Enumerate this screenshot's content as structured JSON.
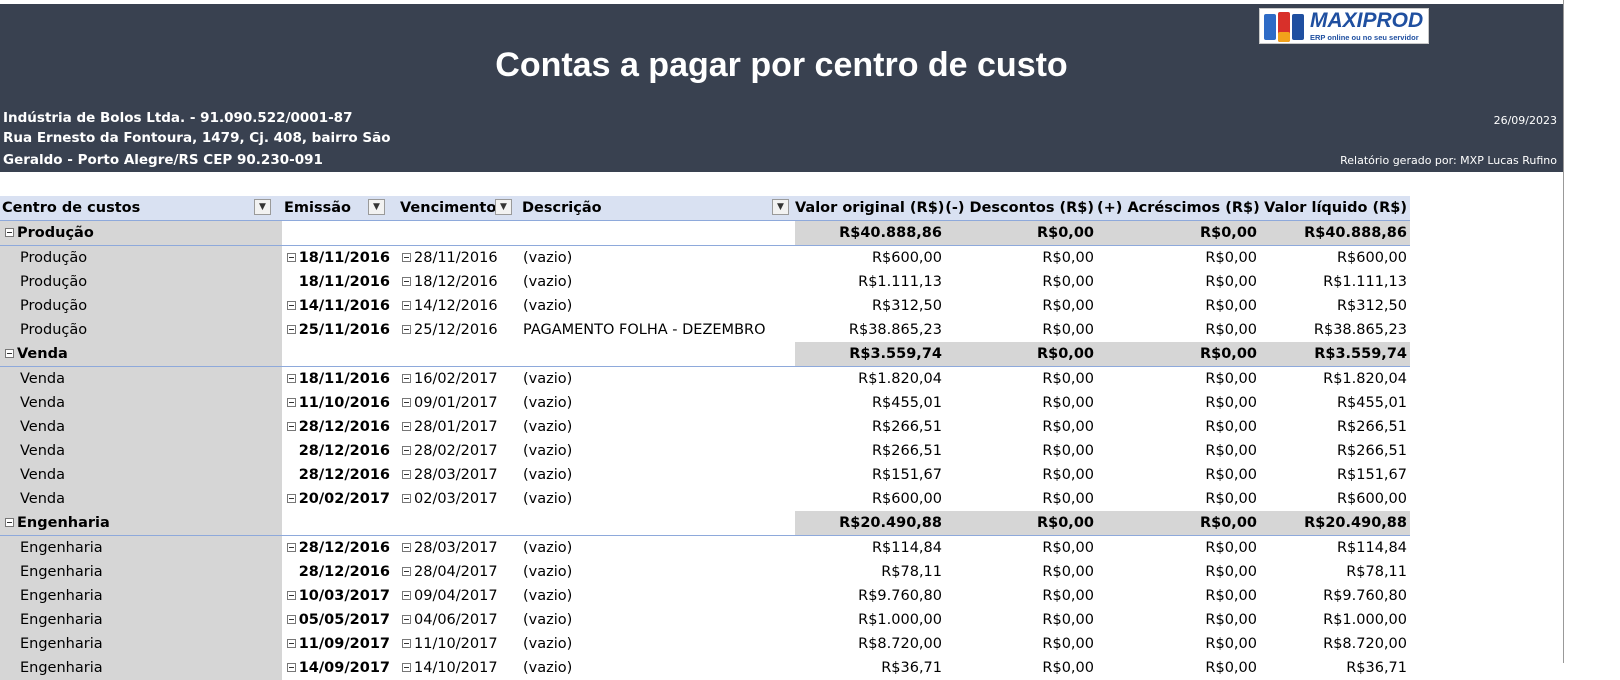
{
  "report": {
    "title": "Contas a pagar por centro de custo",
    "company_line1": "Indústria de Bolos Ltda. - 91.090.522/0001-87",
    "company_line2": "Rua Ernesto da Fontoura, 1479, Cj. 408, bairro São",
    "company_line3": "Geraldo - Porto Alegre/RS CEP 90.230-091",
    "date": "26/09/2023",
    "generated_by": "Relatório gerado por: MXP Lucas Rufino"
  },
  "logo": {
    "name": "MAXIPROD",
    "tagline": "ERP online ou no seu servidor"
  },
  "columns": [
    "Centro de custos",
    "Emissão",
    "Vencimento",
    "Descrição",
    "Valor original (R$)",
    "(-) Descontos (R$)",
    "(+) Acréscimos (R$)",
    "Valor líquido (R$)"
  ],
  "groups": [
    {
      "name": "Produção",
      "totals": [
        "R$40.888,86",
        "R$0,00",
        "R$0,00",
        "R$40.888,86"
      ],
      "rows": [
        {
          "center": "Produção",
          "emissao": "18/11/2016",
          "emissao_toggle": true,
          "vencimento": "28/11/2016",
          "descricao": "(vazio)",
          "valores": [
            "R$600,00",
            "R$0,00",
            "R$0,00",
            "R$600,00"
          ]
        },
        {
          "center": "Produção",
          "emissao": "18/11/2016",
          "emissao_toggle": false,
          "vencimento": "18/12/2016",
          "descricao": "(vazio)",
          "valores": [
            "R$1.111,13",
            "R$0,00",
            "R$0,00",
            "R$1.111,13"
          ]
        },
        {
          "center": "Produção",
          "emissao": "14/11/2016",
          "emissao_toggle": true,
          "vencimento": "14/12/2016",
          "descricao": "(vazio)",
          "valores": [
            "R$312,50",
            "R$0,00",
            "R$0,00",
            "R$312,50"
          ]
        },
        {
          "center": "Produção",
          "emissao": "25/11/2016",
          "emissao_toggle": true,
          "vencimento": "25/12/2016",
          "descricao": "PAGAMENTO FOLHA - DEZEMBRO",
          "valores": [
            "R$38.865,23",
            "R$0,00",
            "R$0,00",
            "R$38.865,23"
          ]
        }
      ]
    },
    {
      "name": "Venda",
      "totals": [
        "R$3.559,74",
        "R$0,00",
        "R$0,00",
        "R$3.559,74"
      ],
      "rows": [
        {
          "center": "Venda",
          "emissao": "18/11/2016",
          "emissao_toggle": true,
          "vencimento": "16/02/2017",
          "descricao": "(vazio)",
          "valores": [
            "R$1.820,04",
            "R$0,00",
            "R$0,00",
            "R$1.820,04"
          ]
        },
        {
          "center": "Venda",
          "emissao": "11/10/2016",
          "emissao_toggle": true,
          "vencimento": "09/01/2017",
          "descricao": "(vazio)",
          "valores": [
            "R$455,01",
            "R$0,00",
            "R$0,00",
            "R$455,01"
          ]
        },
        {
          "center": "Venda",
          "emissao": "28/12/2016",
          "emissao_toggle": true,
          "vencimento": "28/01/2017",
          "descricao": "(vazio)",
          "valores": [
            "R$266,51",
            "R$0,00",
            "R$0,00",
            "R$266,51"
          ]
        },
        {
          "center": "Venda",
          "emissao": "28/12/2016",
          "emissao_toggle": false,
          "vencimento": "28/02/2017",
          "descricao": "(vazio)",
          "valores": [
            "R$266,51",
            "R$0,00",
            "R$0,00",
            "R$266,51"
          ]
        },
        {
          "center": "Venda",
          "emissao": "28/12/2016",
          "emissao_toggle": false,
          "vencimento": "28/03/2017",
          "descricao": "(vazio)",
          "valores": [
            "R$151,67",
            "R$0,00",
            "R$0,00",
            "R$151,67"
          ]
        },
        {
          "center": "Venda",
          "emissao": "20/02/2017",
          "emissao_toggle": true,
          "vencimento": "02/03/2017",
          "descricao": "(vazio)",
          "valores": [
            "R$600,00",
            "R$0,00",
            "R$0,00",
            "R$600,00"
          ]
        }
      ]
    },
    {
      "name": "Engenharia",
      "totals": [
        "R$20.490,88",
        "R$0,00",
        "R$0,00",
        "R$20.490,88"
      ],
      "rows": [
        {
          "center": "Engenharia",
          "emissao": "28/12/2016",
          "emissao_toggle": true,
          "vencimento": "28/03/2017",
          "descricao": "(vazio)",
          "valores": [
            "R$114,84",
            "R$0,00",
            "R$0,00",
            "R$114,84"
          ]
        },
        {
          "center": "Engenharia",
          "emissao": "28/12/2016",
          "emissao_toggle": false,
          "vencimento": "28/04/2017",
          "descricao": "(vazio)",
          "valores": [
            "R$78,11",
            "R$0,00",
            "R$0,00",
            "R$78,11"
          ]
        },
        {
          "center": "Engenharia",
          "emissao": "10/03/2017",
          "emissao_toggle": true,
          "vencimento": "09/04/2017",
          "descricao": "(vazio)",
          "valores": [
            "R$9.760,80",
            "R$0,00",
            "R$0,00",
            "R$9.760,80"
          ]
        },
        {
          "center": "Engenharia",
          "emissao": "05/05/2017",
          "emissao_toggle": true,
          "vencimento": "04/06/2017",
          "descricao": "(vazio)",
          "valores": [
            "R$1.000,00",
            "R$0,00",
            "R$0,00",
            "R$1.000,00"
          ]
        },
        {
          "center": "Engenharia",
          "emissao": "11/09/2017",
          "emissao_toggle": true,
          "vencimento": "11/10/2017",
          "descricao": "(vazio)",
          "valores": [
            "R$8.720,00",
            "R$0,00",
            "R$0,00",
            "R$8.720,00"
          ]
        },
        {
          "center": "Engenharia",
          "emissao": "14/09/2017",
          "emissao_toggle": true,
          "vencimento": "14/10/2017",
          "descricao": "(vazio)",
          "valores": [
            "R$36,71",
            "R$0,00",
            "R$0,00",
            "R$36,71"
          ]
        }
      ]
    }
  ]
}
